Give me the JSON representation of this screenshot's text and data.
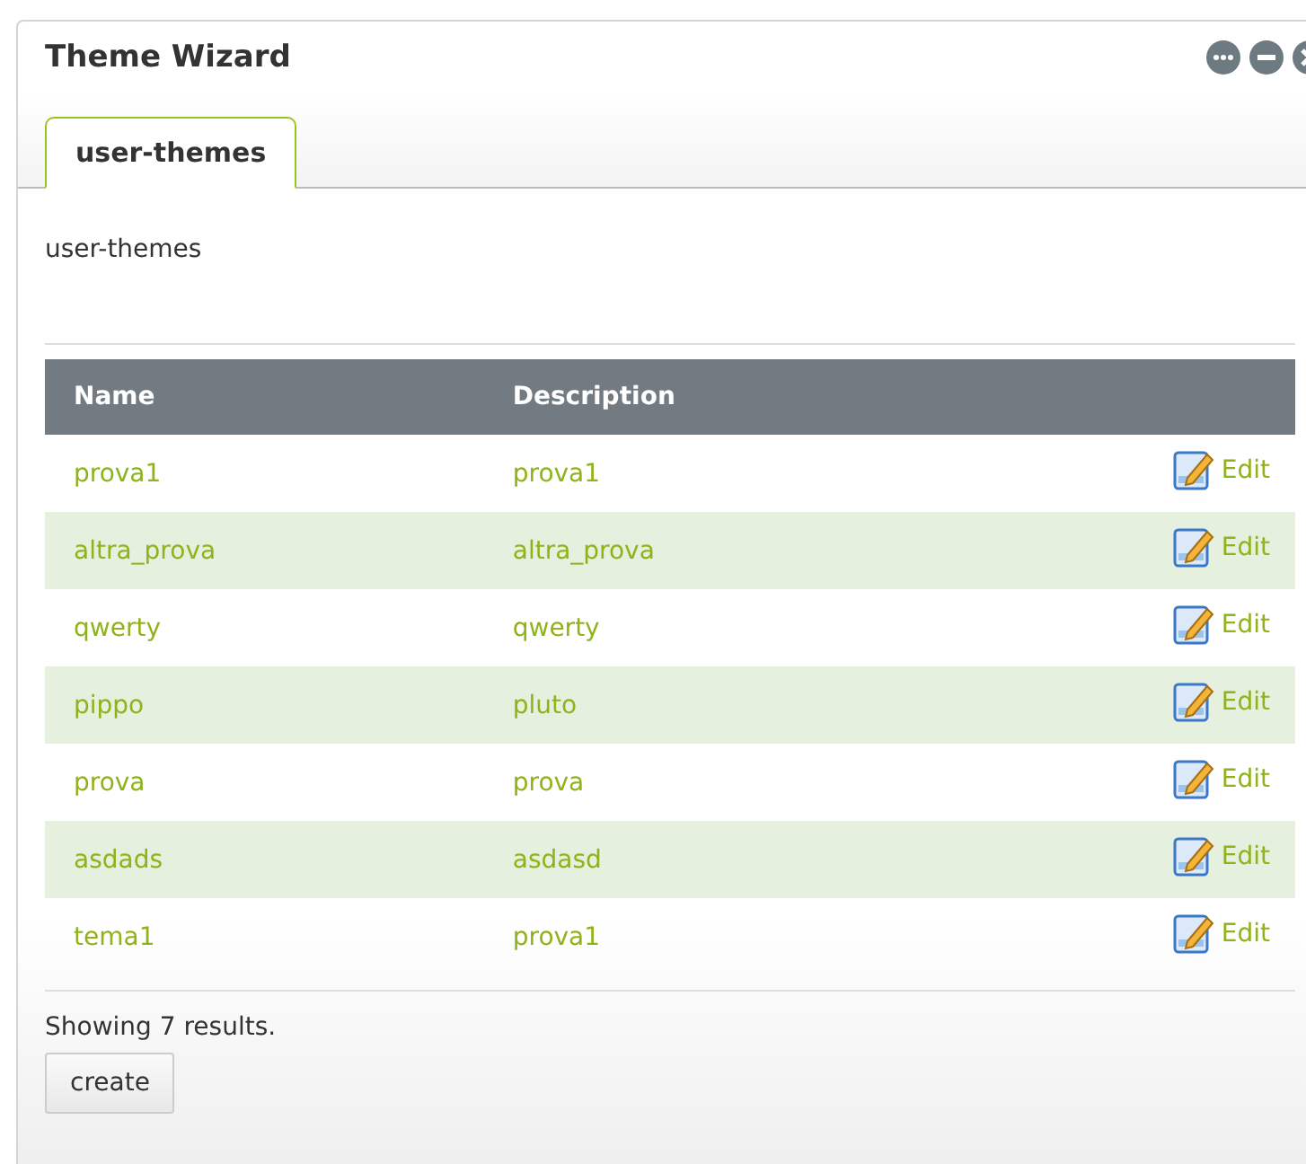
{
  "window": {
    "title": "Theme Wizard"
  },
  "tabs": [
    {
      "label": "user-themes",
      "selected": true
    }
  ],
  "heading": "user-themes",
  "table": {
    "columns": [
      "Name",
      "Description"
    ],
    "rows": [
      {
        "name": "prova1",
        "description": "prova1",
        "action": "Edit"
      },
      {
        "name": "altra_prova",
        "description": "altra_prova",
        "action": "Edit"
      },
      {
        "name": "qwerty",
        "description": "qwerty",
        "action": "Edit"
      },
      {
        "name": "pippo",
        "description": "pluto",
        "action": "Edit"
      },
      {
        "name": "prova",
        "description": "prova",
        "action": "Edit"
      },
      {
        "name": "asdads",
        "description": "asdasd",
        "action": "Edit"
      },
      {
        "name": "tema1",
        "description": "prova1",
        "action": "Edit"
      }
    ]
  },
  "summary": "Showing 7 results.",
  "buttons": [
    "create"
  ]
}
